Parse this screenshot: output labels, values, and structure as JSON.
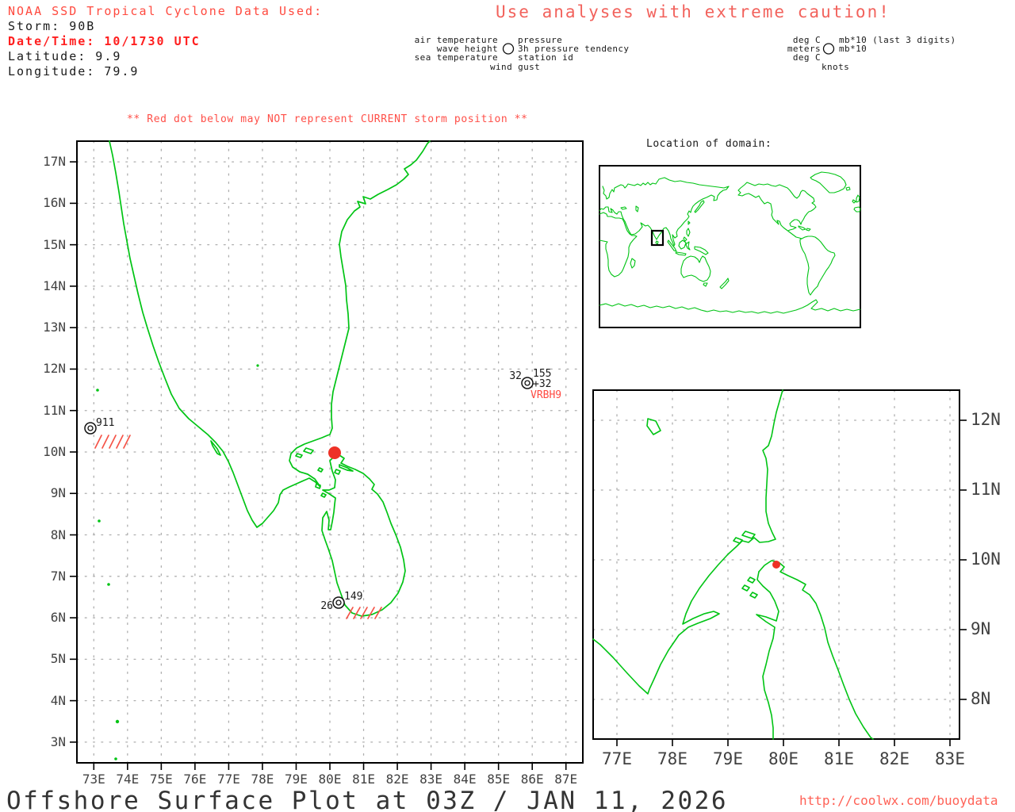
{
  "header": {
    "source_line": "NOAA SSD Tropical Cyclone Data Used:",
    "storm_line": "Storm: 90B",
    "datetime_line": "Date/Time: 10/1730 UTC",
    "latitude_line": "Latitude: 9.9",
    "longitude_line": "Longitude: 79.9"
  },
  "caution_banner": "Use analyses with extreme caution!",
  "station_model_legend": {
    "left_labels": [
      "air temperature",
      "wave height",
      "sea temperature"
    ],
    "right_labels": [
      "pressure",
      "3h pressure tendency",
      "station id"
    ],
    "bottom_label": "wind gust"
  },
  "units_legend": {
    "left_labels": [
      "deg C",
      "meters",
      "deg C"
    ],
    "right_labels": [
      "mb*10 (last 3 digits)",
      "mb*10"
    ],
    "bottom_label": "knots"
  },
  "warning_line": "** Red dot below may NOT represent CURRENT storm position **",
  "main_map": {
    "x_tick_labels": [
      "73E",
      "74E",
      "75E",
      "76E",
      "77E",
      "78E",
      "79E",
      "80E",
      "81E",
      "82E",
      "83E",
      "84E",
      "85E",
      "86E",
      "87E"
    ],
    "y_tick_labels": [
      "17N",
      "16N",
      "15N",
      "14N",
      "13N",
      "12N",
      "11N",
      "10N",
      "9N",
      "8N",
      "7N",
      "6N",
      "5N",
      "4N",
      "3N"
    ]
  },
  "inset_map": {
    "title": "Location of domain:"
  },
  "zoom_map": {
    "x_tick_labels": [
      "77E",
      "78E",
      "79E",
      "80E",
      "81E",
      "82E",
      "83E"
    ],
    "y_tick_labels": [
      "12N",
      "11N",
      "10N",
      "9N",
      "8N"
    ]
  },
  "stations": [
    {
      "id": "VRBH9",
      "air_temperature": "32",
      "pressure": "155",
      "pressure_tendency": "+32"
    },
    {
      "pressure": "911"
    },
    {
      "pressure": "149",
      "sea_temperature": "26"
    }
  ],
  "footer": {
    "title": "Offshore Surface Plot at 03Z / JAN 11, 2026",
    "url": "http://coolwx.com/buoydata"
  },
  "colors": {
    "coast_green": "#00c414",
    "header_red": "#ff4a3f",
    "datetime_red": "#ff1f1f",
    "banner_salmon": "#f2625c",
    "warning_red": "#ff4f48",
    "storm_dot_red": "#ee3126",
    "hatch_red": "#f55347",
    "grid_gray": "#aeaeae",
    "axis_text_gray": "#414141",
    "title_gray": "#343434"
  }
}
